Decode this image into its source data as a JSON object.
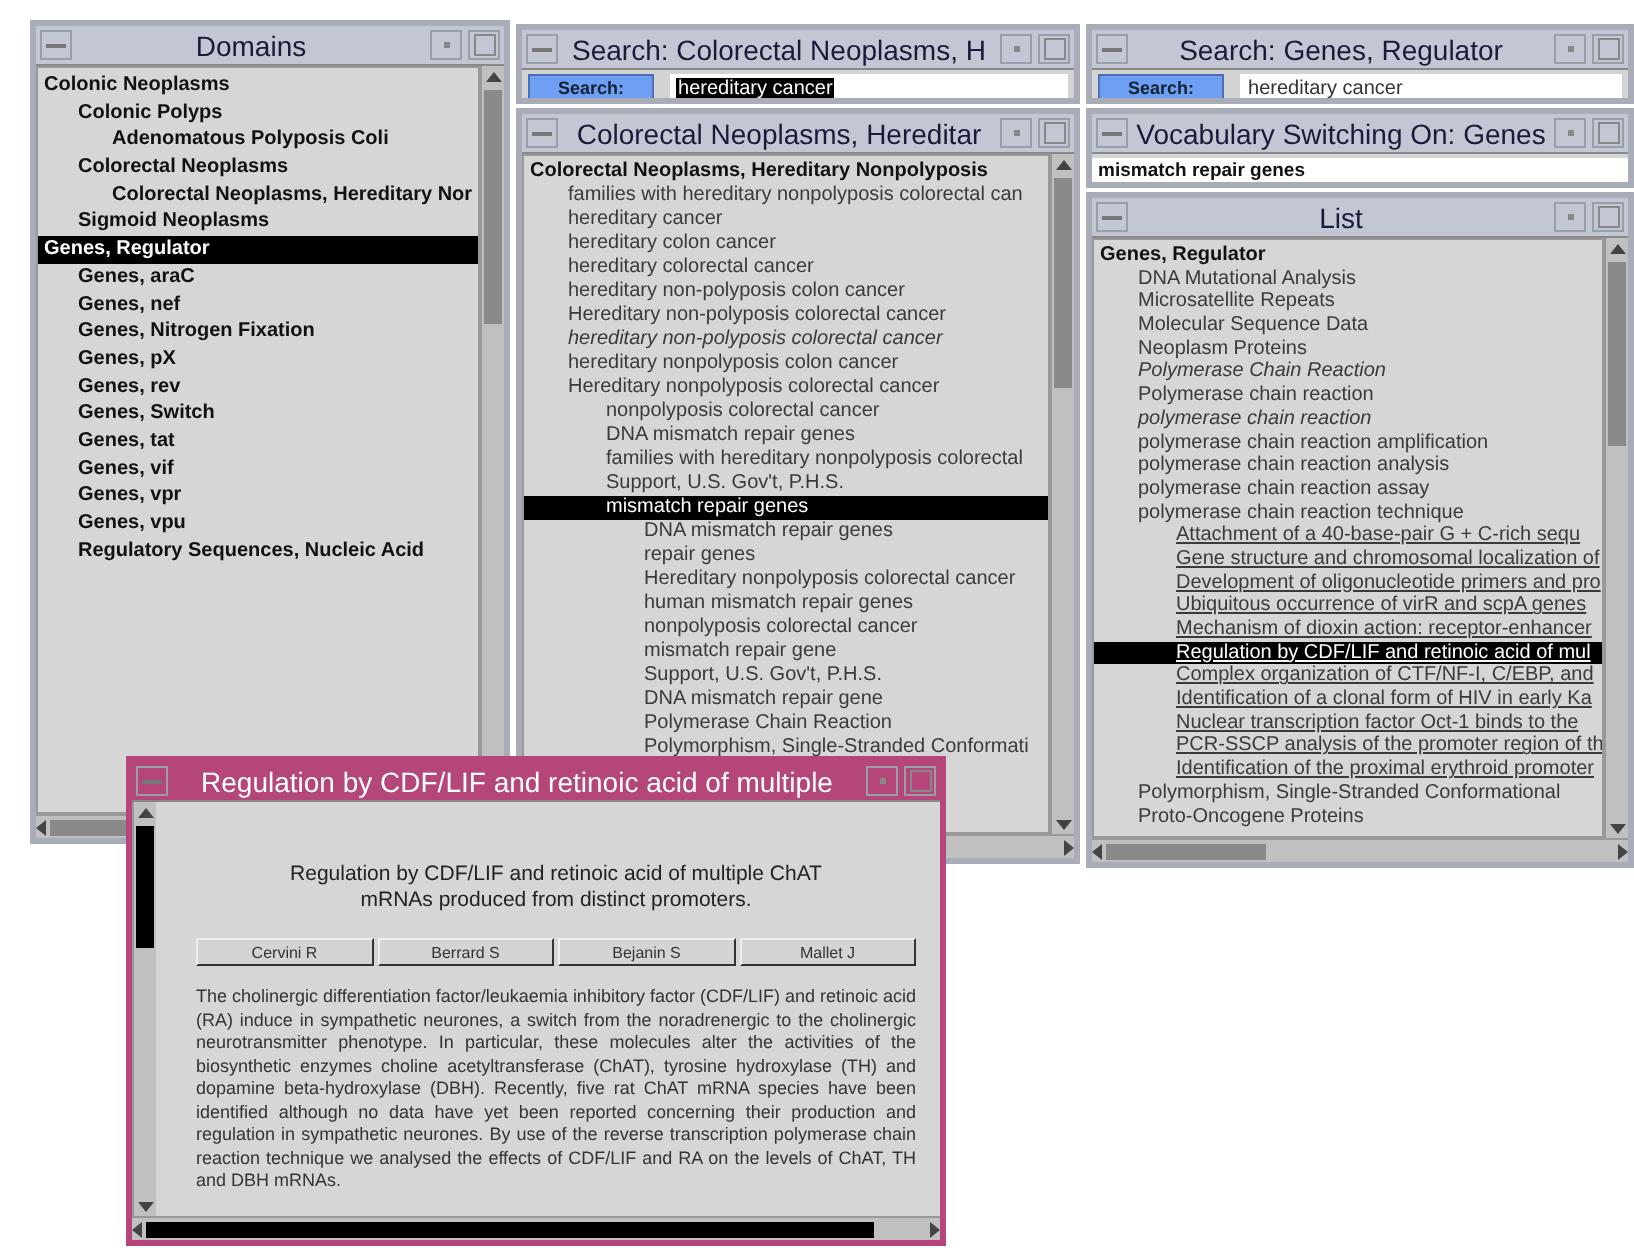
{
  "domains": {
    "title": "Domains",
    "tree": [
      {
        "label": "Colonic Neoplasms",
        "selected": false,
        "children": [
          {
            "label": "Colonic Polyps",
            "selected": false,
            "children": [
              {
                "label": "Adenomatous Polyposis Coli",
                "selected": false
              }
            ]
          },
          {
            "label": "Colorectal Neoplasms",
            "selected": false,
            "children": [
              {
                "label": "Colorectal Neoplasms, Hereditary Nor",
                "selected": false
              }
            ]
          },
          {
            "label": "Sigmoid Neoplasms",
            "selected": false
          }
        ]
      },
      {
        "label": "Genes, Regulator",
        "selected": true,
        "children": [
          {
            "label": "Genes, araC",
            "selected": false
          },
          {
            "label": "Genes, nef",
            "selected": false
          },
          {
            "label": "Genes, Nitrogen Fixation",
            "selected": false
          },
          {
            "label": "Genes, pX",
            "selected": false
          },
          {
            "label": "Genes, rev",
            "selected": false
          },
          {
            "label": "Genes, Switch",
            "selected": false
          },
          {
            "label": "Genes, tat",
            "selected": false
          },
          {
            "label": "Genes, vif",
            "selected": false
          },
          {
            "label": "Genes, vpr",
            "selected": false
          },
          {
            "label": "Genes, vpu",
            "selected": false
          },
          {
            "label": "Regulatory Sequences, Nucleic Acid",
            "selected": false
          }
        ]
      }
    ]
  },
  "search_windows": [
    {
      "title": "Search: Colorectal Neoplasms, H",
      "button": "Search:",
      "value": "hereditary cancer",
      "value_selected": true
    },
    {
      "title": "Search: Genes, Regulator",
      "button": "Search:",
      "value": "hereditary cancer",
      "value_selected": false
    }
  ],
  "term_window": {
    "title": "Colorectal Neoplasms, Hereditar",
    "tree": [
      {
        "label": "Colorectal Neoplasms, Hereditary Nonpolyposis",
        "kind": "heading",
        "selected": false,
        "children": [
          {
            "label": "families with hereditary nonpolyposis colorectal can",
            "kind": "term",
            "selected": false
          },
          {
            "label": "hereditary cancer",
            "kind": "term",
            "selected": false
          },
          {
            "label": "hereditary colon cancer",
            "kind": "term",
            "selected": false
          },
          {
            "label": "hereditary colorectal cancer",
            "kind": "term",
            "selected": false
          },
          {
            "label": "hereditary non-polyposis colon cancer",
            "kind": "term",
            "selected": false
          },
          {
            "label": "Hereditary non-polyposis colorectal cancer",
            "kind": "term",
            "selected": false
          },
          {
            "label": "hereditary non-polyposis colorectal cancer",
            "kind": "variant",
            "selected": false
          },
          {
            "label": "hereditary nonpolyposis colon cancer",
            "kind": "term",
            "selected": false
          },
          {
            "label": "Hereditary nonpolyposis colorectal cancer",
            "kind": "term",
            "selected": false,
            "children": [
              {
                "label": "nonpolyposis colorectal cancer",
                "kind": "term",
                "selected": false
              },
              {
                "label": "DNA mismatch repair genes",
                "kind": "term",
                "selected": false
              },
              {
                "label": "families with hereditary nonpolyposis colorectal",
                "kind": "term",
                "selected": false
              },
              {
                "label": "Support, U.S. Gov't, P.H.S.",
                "kind": "term",
                "selected": false
              },
              {
                "label": "mismatch repair genes",
                "kind": "term",
                "selected": true,
                "children": [
                  {
                    "label": "DNA mismatch repair genes",
                    "kind": "term",
                    "selected": false
                  },
                  {
                    "label": "repair genes",
                    "kind": "term",
                    "selected": false
                  },
                  {
                    "label": "Hereditary nonpolyposis colorectal cancer",
                    "kind": "term",
                    "selected": false
                  },
                  {
                    "label": "human mismatch repair genes",
                    "kind": "term",
                    "selected": false
                  },
                  {
                    "label": "nonpolyposis colorectal cancer",
                    "kind": "term",
                    "selected": false
                  },
                  {
                    "label": "mismatch repair gene",
                    "kind": "term",
                    "selected": false
                  },
                  {
                    "label": "Support, U.S. Gov't, P.H.S.",
                    "kind": "term",
                    "selected": false
                  },
                  {
                    "label": "DNA mismatch repair gene",
                    "kind": "term",
                    "selected": false
                  },
                  {
                    "label": "Polymerase Chain Reaction",
                    "kind": "term",
                    "selected": false
                  },
                  {
                    "label": "Polymorphism, Single-Stranded Conformati",
                    "kind": "term",
                    "selected": false
                  }
                ]
              }
            ]
          }
        ]
      }
    ]
  },
  "vocabulary_window": {
    "title": "Vocabulary Switching On: Genes",
    "value": "mismatch repair genes"
  },
  "list_window": {
    "title": "List",
    "tree": [
      {
        "label": "Genes, Regulator",
        "kind": "heading",
        "selected": false,
        "children": [
          {
            "label": "DNA Mutational Analysis",
            "kind": "term",
            "selected": false
          },
          {
            "label": "Microsatellite Repeats",
            "kind": "term",
            "selected": false
          },
          {
            "label": "Molecular Sequence Data",
            "kind": "term",
            "selected": false
          },
          {
            "label": "Neoplasm Proteins",
            "kind": "term",
            "selected": false
          },
          {
            "label": "Polymerase Chain Reaction",
            "kind": "variant",
            "selected": false
          },
          {
            "label": "Polymerase chain reaction",
            "kind": "term",
            "selected": false
          },
          {
            "label": "polymerase chain reaction",
            "kind": "variant",
            "selected": false
          },
          {
            "label": "polymerase chain reaction amplification",
            "kind": "term",
            "selected": false
          },
          {
            "label": "polymerase chain reaction analysis",
            "kind": "term",
            "selected": false
          },
          {
            "label": "polymerase chain reaction assay",
            "kind": "term",
            "selected": false
          },
          {
            "label": "polymerase chain reaction technique",
            "kind": "term",
            "selected": false,
            "children": [
              {
                "label": "Attachment of a 40-base-pair G + C-rich sequ",
                "kind": "citation",
                "selected": false
              },
              {
                "label": "Gene structure and chromosomal localization of",
                "kind": "citation",
                "selected": false
              },
              {
                "label": "Development of oligonucleotide primers and pro",
                "kind": "citation",
                "selected": false
              },
              {
                "label": "Ubiquitous occurrence of virR and scpA genes",
                "kind": "citation",
                "selected": false
              },
              {
                "label": "Mechanism of dioxin action: receptor-enhancer",
                "kind": "citation",
                "selected": false
              },
              {
                "label": "Regulation by CDF/LIF and retinoic acid of mul",
                "kind": "citation",
                "selected": true
              },
              {
                "label": "Complex organization of CTF/NF-I, C/EBP, and",
                "kind": "citation",
                "selected": false
              },
              {
                "label": "Identification of a clonal form of HIV in early Ka",
                "kind": "citation",
                "selected": false
              },
              {
                "label": "Nuclear transcription factor Oct-1 binds to the",
                "kind": "citation",
                "selected": false
              },
              {
                "label": "PCR-SSCP analysis of the promoter region of th",
                "kind": "citation",
                "selected": false
              },
              {
                "label": "Identification of the proximal erythroid promoter",
                "kind": "citation",
                "selected": false
              }
            ]
          },
          {
            "label": "Polymorphism, Single-Stranded Conformational",
            "kind": "term",
            "selected": false
          },
          {
            "label": "Proto-Oncogene Proteins",
            "kind": "term",
            "selected": false
          }
        ]
      }
    ]
  },
  "article_window": {
    "title": "Regulation by CDF/LIF and retinoic acid of multiple",
    "heading": "Regulation by CDF/LIF and retinoic acid of multiple ChAT mRNAs produced from distinct promoters.",
    "authors": [
      "Cervini R",
      "Berrard S",
      "Bejanin S",
      "Mallet J"
    ],
    "abstract": "The cholinergic differentiation factor/leukaemia inhibitory factor (CDF/LIF) and retinoic acid (RA) induce in sympathetic neurones, a switch from the noradrenergic to the cholinergic neurotransmitter phenotype. In particular, these molecules alter the activities of the biosynthetic enzymes choline acetyltransferase (ChAT), tyrosine hydroxylase (TH) and dopamine beta-hydroxylase (DBH). Recently, five rat ChAT mRNA species have been identified although no data have yet been reported concerning their production and regulation in sympathetic neurones. By use of the reverse transcription polymerase chain reaction technique we analysed the effects of CDF/LIF and RA on the levels of ChAT, TH and DBH mRNAs."
  }
}
